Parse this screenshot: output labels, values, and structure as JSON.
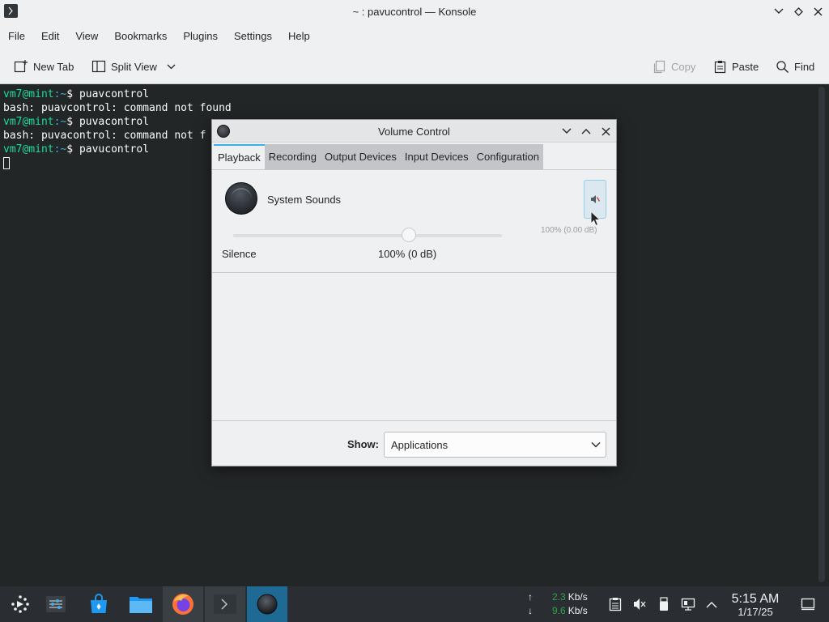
{
  "konsole": {
    "title": "~ : pavucontrol — Konsole",
    "menu": [
      "File",
      "Edit",
      "View",
      "Bookmarks",
      "Plugins",
      "Settings",
      "Help"
    ],
    "toolbar": {
      "new_tab": "New Tab",
      "split_view": "Split View",
      "copy": "Copy",
      "paste": "Paste",
      "find": "Find"
    },
    "terminal": {
      "prompt_user": "vm7@mint",
      "prompt_path": ":~",
      "prompt_symbol": "$ ",
      "lines": [
        {
          "type": "cmd",
          "text": "puavcontrol"
        },
        {
          "type": "out",
          "text": "bash: puavcontrol: command not found"
        },
        {
          "type": "cmd",
          "text": "puvacontrol"
        },
        {
          "type": "out",
          "text": "bash: puvacontrol: command not f"
        },
        {
          "type": "cmd",
          "text": "pavucontrol"
        }
      ]
    }
  },
  "volume_control": {
    "title": "Volume Control",
    "tabs": [
      "Playback",
      "Recording",
      "Output Devices",
      "Input Devices",
      "Configuration"
    ],
    "active_tab": "Playback",
    "stream": {
      "name": "System Sounds",
      "level_readout": "100% (0.00 dB)",
      "label_min": "Silence",
      "label_100": "100% (0 dB)",
      "volume_fraction_of_track": 0.655
    },
    "show_label": "Show:",
    "show_value": "Applications"
  },
  "taskbar": {
    "network": {
      "up_arrow": "↑",
      "down_arrow": "↓",
      "up_value": "2.3",
      "down_value": "9.6",
      "unit": "Kb/s"
    },
    "clock": {
      "time": "5:15 AM",
      "date": "1/17/25"
    }
  },
  "colors": {
    "accent": "#3daee9",
    "terminal_bg": "#232627",
    "prompt_user": "#1cdc9a",
    "prompt_path": "#3daee9"
  }
}
